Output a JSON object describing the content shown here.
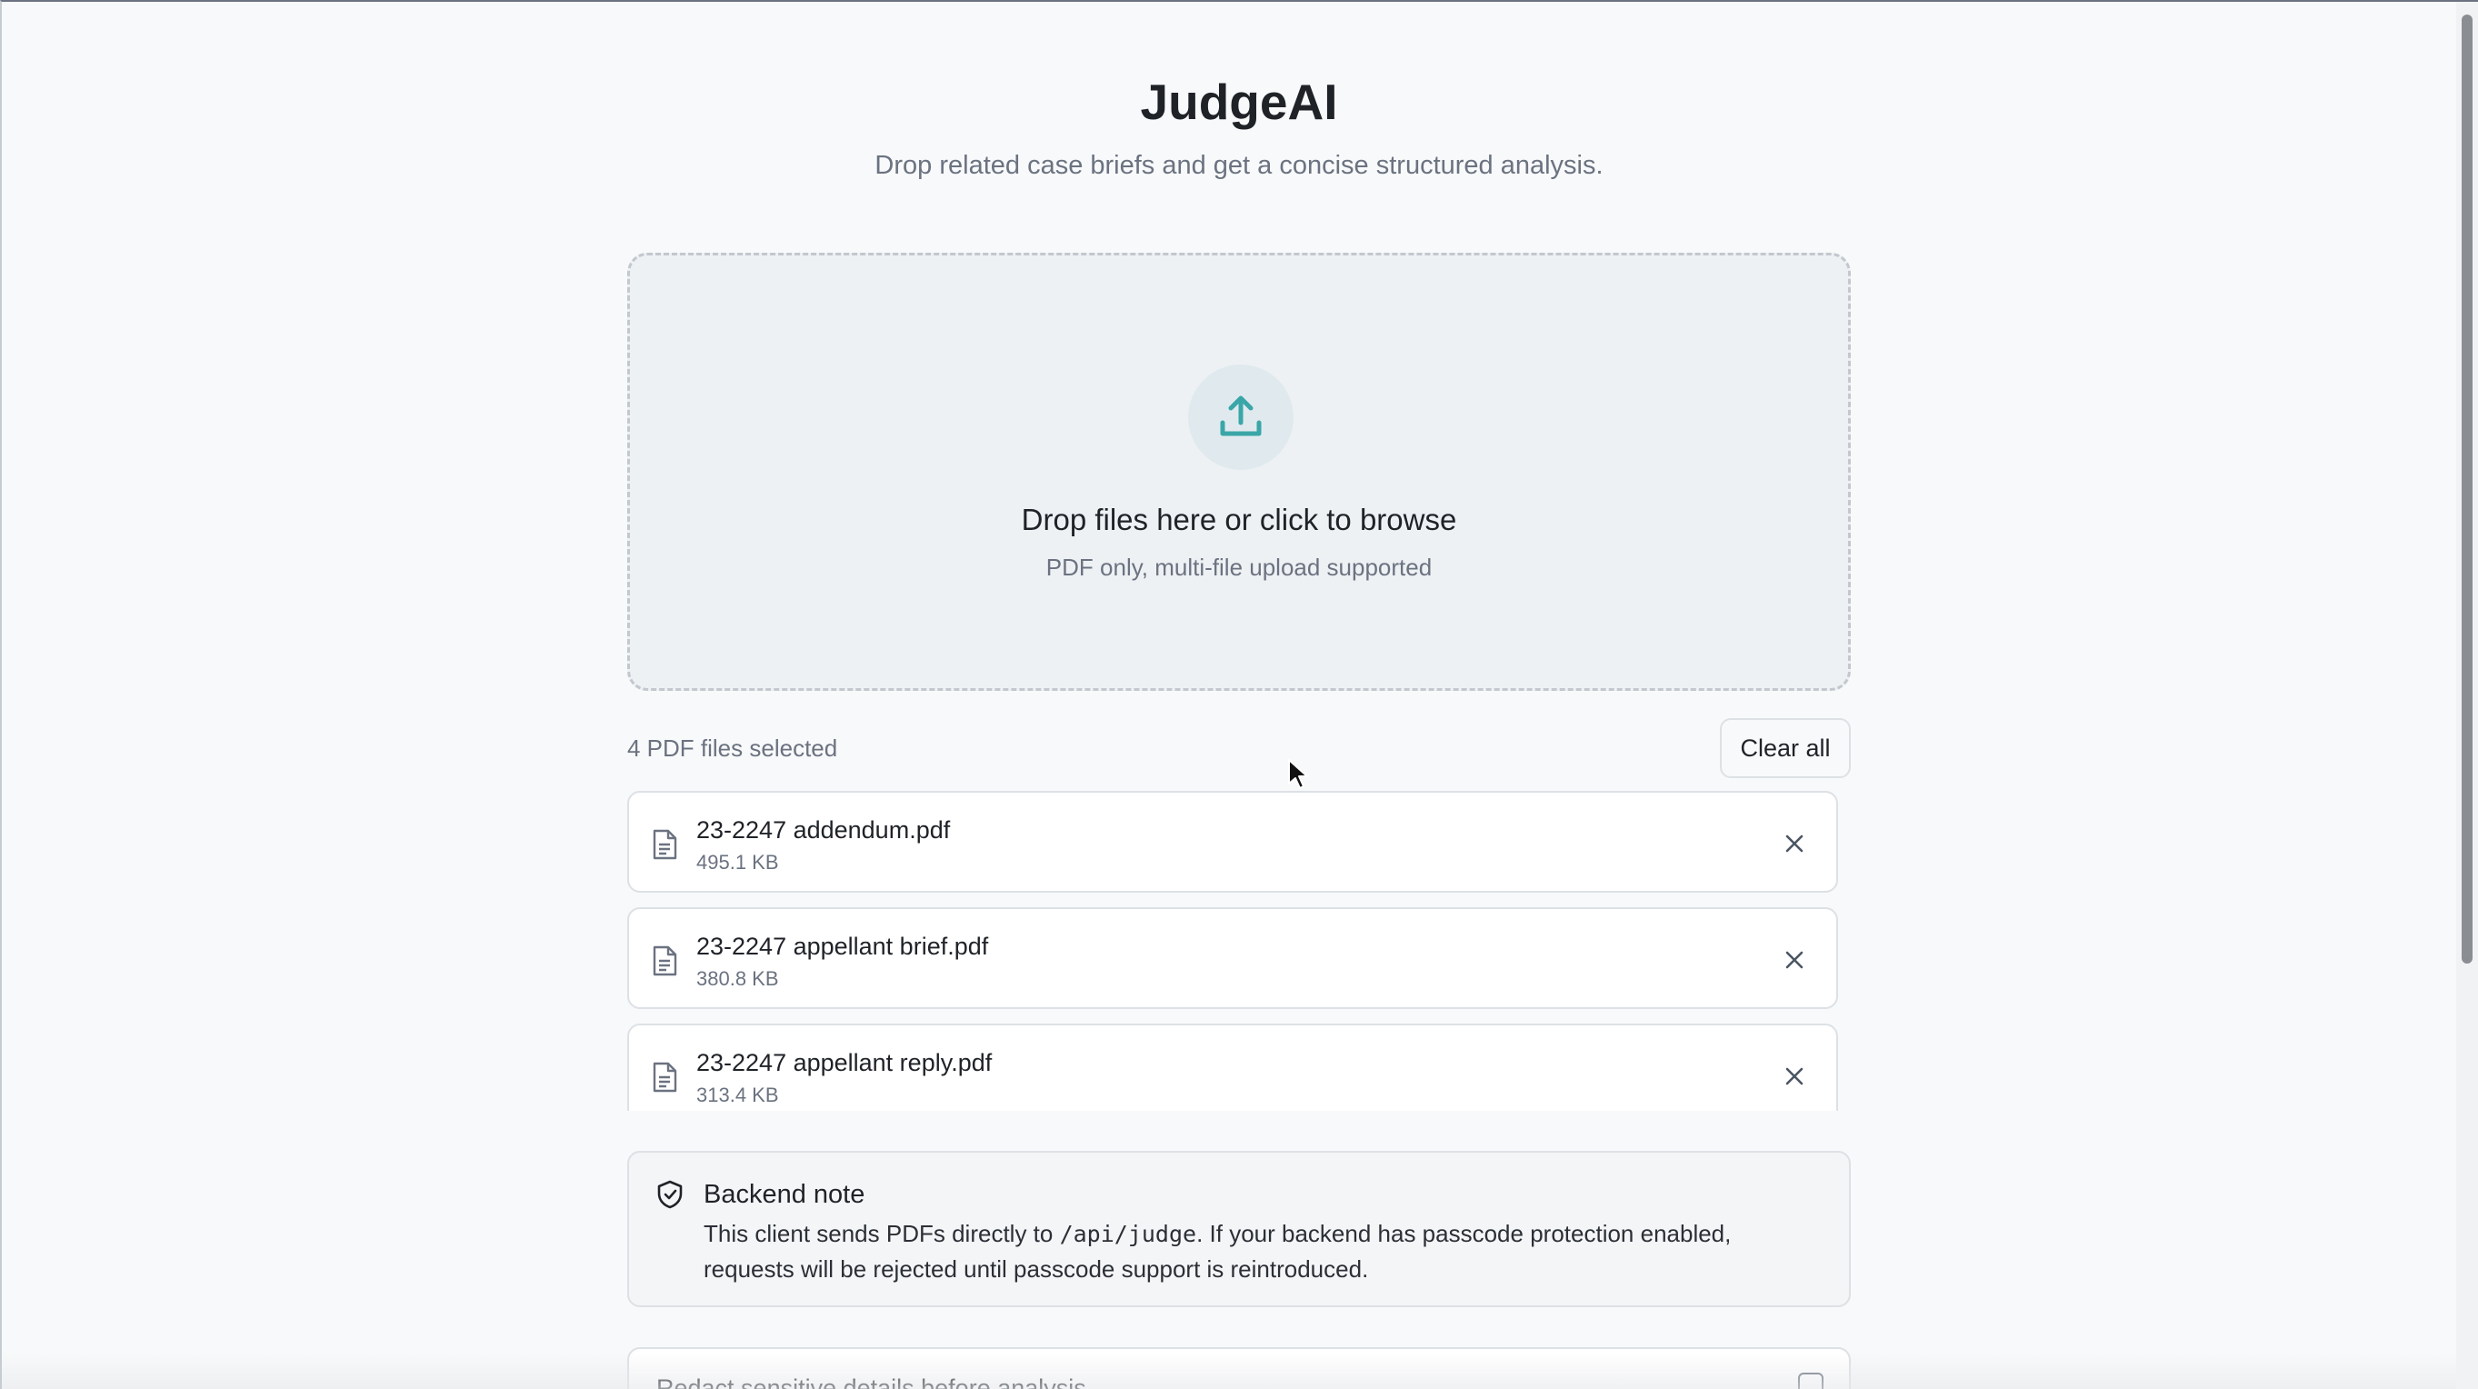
{
  "header": {
    "title": "JudgeAI",
    "subtitle": "Drop related case briefs and get a concise structured analysis."
  },
  "dropzone": {
    "icon": "upload-icon",
    "title": "Drop files here or click to browse",
    "hint": "PDF only, multi-file upload supported"
  },
  "files": {
    "count_label": "4 PDF files selected",
    "clear_label": "Clear all",
    "items": [
      {
        "name": "23-2247 addendum.pdf",
        "size": "495.1 KB"
      },
      {
        "name": "23-2247 appellant brief.pdf",
        "size": "380.8 KB"
      },
      {
        "name": "23-2247 appellant reply.pdf",
        "size": "313.4 KB"
      }
    ]
  },
  "note": {
    "icon": "shield-check-icon",
    "title": "Backend note",
    "body_before": "This client sends PDFs directly to ",
    "body_code": "/api/judge",
    "body_after": ". If your backend has passcode protection enabled, requests will be rejected until passcode support is reintroduced."
  },
  "redact": {
    "label": "Redact sensitive details before analysis",
    "checked": false
  },
  "colors": {
    "accent": "#3aa6a8",
    "text": "#1f2328",
    "muted": "#6b7280",
    "border": "#dde1e5",
    "dropzone_bg": "#eef1f4"
  }
}
